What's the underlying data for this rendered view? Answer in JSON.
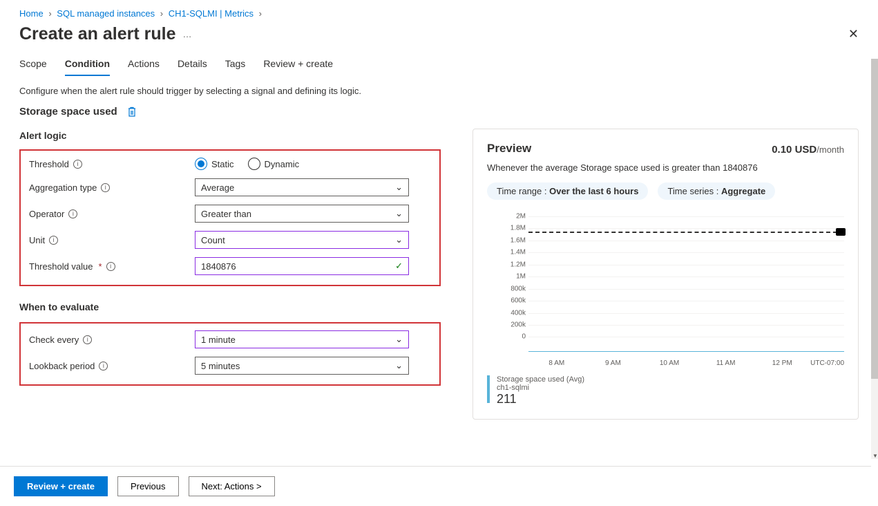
{
  "breadcrumb": [
    {
      "label": "Home"
    },
    {
      "label": "SQL managed instances"
    },
    {
      "label": "CH1-SQLMI | Metrics"
    }
  ],
  "title": "Create an alert rule",
  "tabs": [
    "Scope",
    "Condition",
    "Actions",
    "Details",
    "Tags",
    "Review + create"
  ],
  "active_tab": "Condition",
  "description": "Configure when the alert rule should trigger by selecting a signal and defining its logic.",
  "signal_name": "Storage space used",
  "alert_logic": {
    "heading": "Alert logic",
    "threshold_label": "Threshold",
    "threshold_options": [
      "Static",
      "Dynamic"
    ],
    "threshold_selected": "Static",
    "aggregation_label": "Aggregation type",
    "aggregation_value": "Average",
    "operator_label": "Operator",
    "operator_value": "Greater than",
    "unit_label": "Unit",
    "unit_value": "Count",
    "threshold_value_label": "Threshold value",
    "threshold_value": "1840876"
  },
  "when_evaluate": {
    "heading": "When to evaluate",
    "check_label": "Check every",
    "check_value": "1 minute",
    "lookback_label": "Lookback period",
    "lookback_value": "5 minutes"
  },
  "preview": {
    "heading": "Preview",
    "price_amount": "0.10 USD",
    "price_per": "/month",
    "description": "Whenever the average Storage space used is greater than 1840876",
    "pill1_prefix": "Time range : ",
    "pill1_value": "Over the last 6 hours",
    "pill2_prefix": "Time series : ",
    "pill2_value": "Aggregate",
    "legend_line1": "Storage space used (Avg)",
    "legend_line2": "ch1-sqlmi",
    "legend_value": "211"
  },
  "chart_data": {
    "type": "line",
    "ylabel": "",
    "xlabel": "",
    "ylim": [
      0,
      2000000
    ],
    "y_ticks": [
      "0",
      "200k",
      "400k",
      "600k",
      "800k",
      "1M",
      "1.2M",
      "1.4M",
      "1.6M",
      "1.8M",
      "2M"
    ],
    "x_ticks": [
      "8 AM",
      "9 AM",
      "10 AM",
      "11 AM",
      "12 PM",
      "UTC-07:00"
    ],
    "threshold": 1840876,
    "series": [
      {
        "name": "Storage space used (Avg)",
        "approx_value": 211
      }
    ]
  },
  "footer": {
    "review": "Review + create",
    "previous": "Previous",
    "next": "Next: Actions >"
  }
}
